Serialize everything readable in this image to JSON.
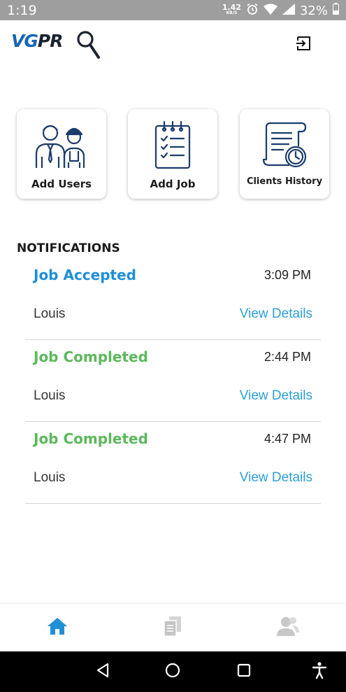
{
  "status_bar": {
    "time": "1:19",
    "net_speed_value": "1.42",
    "net_speed_unit": "KB/S",
    "battery": "32%"
  },
  "header": {
    "logo_part1": "VG",
    "logo_part2": "PR",
    "logout_icon": "logout-icon"
  },
  "actions": [
    {
      "label": "Add Users",
      "icon": "users-icon"
    },
    {
      "label": "Add Job",
      "icon": "checklist-icon"
    },
    {
      "label": "Clients History",
      "icon": "history-icon"
    }
  ],
  "notifications": {
    "title": "NOTIFICATIONS",
    "items": [
      {
        "title": "Job Accepted",
        "time": "3:09 PM",
        "user": "Louis",
        "link": "View Details",
        "status_color": "#1f8fd6"
      },
      {
        "title": "Job Completed",
        "time": "2:44 PM",
        "user": "Louis",
        "link": "View Details",
        "status_color": "#5cb85c"
      },
      {
        "title": "Job Completed",
        "time": "4:47 PM",
        "user": "Louis",
        "link": "View Details",
        "status_color": "#5cb85c"
      }
    ]
  },
  "bottom_nav": [
    {
      "icon": "home-icon",
      "active": true
    },
    {
      "icon": "documents-icon",
      "active": false
    },
    {
      "icon": "profile-icon",
      "active": false
    }
  ],
  "colors": {
    "accent": "#1f8fd6",
    "success": "#5cb85c",
    "link": "#2b9fd8"
  }
}
